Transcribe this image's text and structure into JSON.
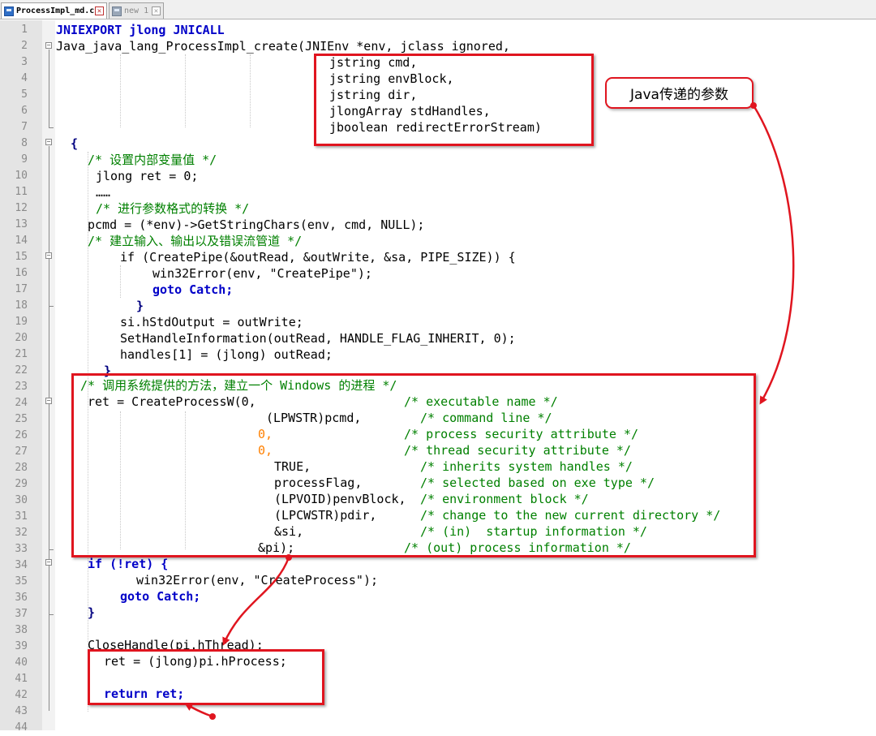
{
  "tabs": [
    {
      "label": "ProcessImpl_md.c",
      "icon": "file-icon",
      "active": true
    },
    {
      "label": "new 1",
      "icon": "file-icon",
      "active": false
    }
  ],
  "annotation": {
    "label": "Java传递的参数",
    "color": "#e0151f"
  },
  "line_numbers": [
    "1",
    "2",
    "3",
    "4",
    "5",
    "6",
    "7",
    "8",
    "9",
    "10",
    "11",
    "12",
    "13",
    "14",
    "15",
    "16",
    "17",
    "18",
    "19",
    "20",
    "21",
    "22",
    "23",
    "24",
    "25",
    "26",
    "27",
    "28",
    "29",
    "30",
    "31",
    "32",
    "33",
    "34",
    "35",
    "36",
    "37",
    "38",
    "39",
    "40",
    "41",
    "42",
    "43",
    "44"
  ],
  "code_lines": [
    "JNIEXPORT jlong JNICALL",
    "Java_java_lang_ProcessImpl_create(JNIEnv *env, jclass ignored,",
    "jstring cmd,",
    "jstring envBlock,",
    "jstring dir,",
    "jlongArray stdHandles,",
    "jboolean redirectErrorStream)",
    "",
    "{",
    "/* 设置内部变量值 */",
    "jlong ret = 0;",
    "……",
    "/* 进行参数格式的转换 */",
    "pcmd = (*env)->GetStringChars(env, cmd, NULL);",
    "/* 建立输入、输出以及错误流管道 */",
    "if (CreatePipe(&outRead, &outWrite, &sa, PIPE_SIZE)) {",
    "win32Error(env, \"CreatePipe\");",
    "goto Catch;",
    "}",
    "si.hStdOutput = outWrite;",
    "SetHandleInformation(outRead, HANDLE_FLAG_INHERIT, 0);",
    "handles[1] = (jlong) outRead;",
    "}",
    "/* 调用系统提供的方法，建立一个 Windows 的进程 */",
    "ret = CreateProcessW(0,",
    "(LPWSTR)pcmd,",
    "0,",
    "0,",
    "TRUE,",
    "processFlag,",
    "(LPVOID)penvBlock,",
    "(LPCWSTR)pdir,",
    "&si,",
    "&pi);",
    "if (!ret) {",
    "win32Error(env, \"CreateProcess\");",
    "goto Catch;",
    "}",
    "",
    "CloseHandle(pi.hThread);",
    "ret = (jlong)pi.hProcess;",
    "",
    "return ret;",
    ""
  ],
  "inline_comments": [
    "/* executable name */",
    "/* command line */",
    "/* process security attribute */",
    "/* thread security attribute */",
    "/* inherits system handles */",
    "/* selected based on exe type */",
    "/* environment block */",
    "/* change to the new current directory */",
    "/* (in)  startup information */",
    "/* (out) process information */"
  ]
}
